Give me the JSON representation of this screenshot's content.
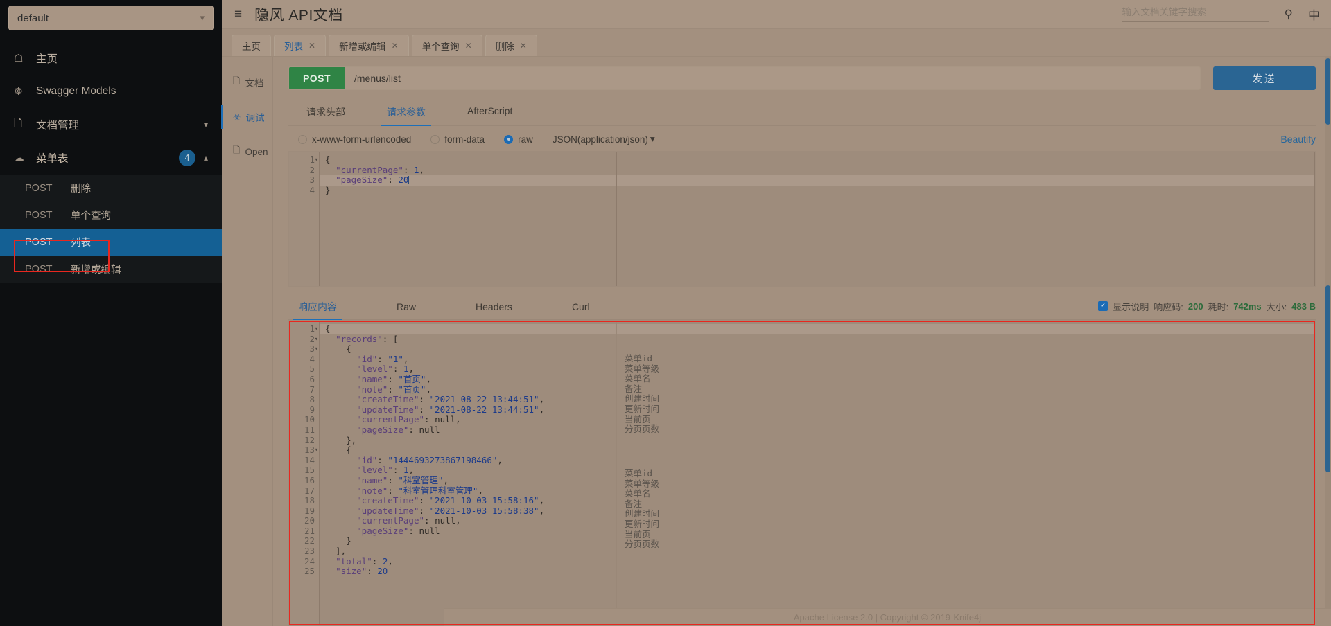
{
  "sidebar": {
    "env": {
      "value": "default",
      "chevron": "chevron-down-icon"
    },
    "nav": [
      {
        "icon": "home-icon",
        "glyph": "⌂",
        "label": "主页"
      },
      {
        "icon": "swagger-icon",
        "glyph": "☸",
        "label": "Swagger Models"
      },
      {
        "icon": "doc-icon",
        "glyph": "὜8",
        "label": "文档管理",
        "caret": "ˇ"
      },
      {
        "icon": "cloud-icon",
        "glyph": "☁",
        "label": "菜单表",
        "badge": "4",
        "caret": "˄"
      }
    ],
    "endpoints": [
      {
        "method": "POST",
        "name": "删除",
        "selected": false
      },
      {
        "method": "POST",
        "name": "单个查询",
        "selected": false
      },
      {
        "method": "POST",
        "name": "列表",
        "selected": true
      },
      {
        "method": "POST",
        "name": "新增或编辑",
        "selected": false
      }
    ]
  },
  "topbar": {
    "collapse_icon": "collapse-sidebar-icon",
    "title": "隐风 API文档",
    "search_placeholder": "输入文档关键字搜索",
    "search_value": "",
    "search_icon": "search-icon",
    "lang_label": "中"
  },
  "tabs": [
    {
      "label": "主页",
      "closable": false,
      "active": false
    },
    {
      "label": "列表",
      "closable": true,
      "active": true
    },
    {
      "label": "新增或编辑",
      "closable": true,
      "active": false
    },
    {
      "label": "单个查询",
      "closable": true,
      "active": false
    },
    {
      "label": "删除",
      "closable": true,
      "active": false
    }
  ],
  "leftnav": [
    {
      "icon": "document-icon",
      "glyph": "὜b",
      "label": "文档",
      "active": false
    },
    {
      "icon": "bug-icon",
      "glyph": "☣",
      "label": "调试",
      "active": true
    },
    {
      "icon": "open-file-icon",
      "glyph": "὜b",
      "label": "Open",
      "active": false
    }
  ],
  "request": {
    "method": "POST",
    "url": "/menus/list",
    "send_label": "发送",
    "subtabs": [
      {
        "label": "请求头部",
        "active": false
      },
      {
        "label": "请求参数",
        "active": true
      },
      {
        "label": "AfterScript",
        "active": false
      }
    ],
    "body_types": [
      {
        "label": "x-www-form-urlencoded",
        "selected": false
      },
      {
        "label": "form-data",
        "selected": false
      },
      {
        "label": "raw",
        "selected": true
      }
    ],
    "content_type": "JSON(application/json)",
    "content_type_caret": "⌄",
    "beautify_label": "Beautify",
    "body_lines": [
      {
        "n": "1",
        "fold": true,
        "html": "{"
      },
      {
        "n": "2",
        "fold": false,
        "html": "  <span class='k'>\"currentPage\"</span>: <span class='n'>1</span>,"
      },
      {
        "n": "3",
        "fold": false,
        "hl": true,
        "html": "  <span class='k'>\"pageSize\"</span>: <span class='n'>20</span><span class='caret-bar'></span>"
      },
      {
        "n": "4",
        "fold": false,
        "html": "}"
      }
    ]
  },
  "response": {
    "tabs": [
      {
        "label": "响应内容",
        "active": true
      },
      {
        "label": "Raw",
        "active": false
      },
      {
        "label": "Headers",
        "active": false
      },
      {
        "label": "Curl",
        "active": false
      }
    ],
    "show_desc_label": "显示说明",
    "show_desc_checked": true,
    "status_code_label": "响应码:",
    "status_code_value": "200",
    "time_label": "耗时:",
    "time_value": "742ms",
    "size_label": "大小:",
    "size_value": "483 B",
    "body_lines": [
      {
        "n": "1",
        "fold": true,
        "hl": true,
        "html": "{"
      },
      {
        "n": "2",
        "fold": true,
        "html": "  <span class='k'>\"records\"</span>: ["
      },
      {
        "n": "3",
        "fold": true,
        "html": "    {"
      },
      {
        "n": "4",
        "fold": false,
        "html": "      <span class='k'>\"id\"</span>: <span class='s'>\"1\"</span>,"
      },
      {
        "n": "5",
        "fold": false,
        "html": "      <span class='k'>\"level\"</span>: <span class='n'>1</span>,"
      },
      {
        "n": "6",
        "fold": false,
        "html": "      <span class='k'>\"name\"</span>: <span class='cz'>\"首页\"</span>,"
      },
      {
        "n": "7",
        "fold": false,
        "html": "      <span class='k'>\"note\"</span>: <span class='cz'>\"首页\"</span>,"
      },
      {
        "n": "8",
        "fold": false,
        "html": "      <span class='k'>\"createTime\"</span>: <span class='s'>\"2021-08-22 13:44:51\"</span>,"
      },
      {
        "n": "9",
        "fold": false,
        "html": "      <span class='k'>\"updateTime\"</span>: <span class='s'>\"2021-08-22 13:44:51\"</span>,"
      },
      {
        "n": "10",
        "fold": false,
        "html": "      <span class='k'>\"currentPage\"</span>: <span class='nul'>null</span>,"
      },
      {
        "n": "11",
        "fold": false,
        "html": "      <span class='k'>\"pageSize\"</span>: <span class='nul'>null</span>"
      },
      {
        "n": "12",
        "fold": false,
        "html": "    },"
      },
      {
        "n": "13",
        "fold": true,
        "html": "    {"
      },
      {
        "n": "14",
        "fold": false,
        "html": "      <span class='k'>\"id\"</span>: <span class='s'>\"1444693273867198466\"</span>,"
      },
      {
        "n": "15",
        "fold": false,
        "html": "      <span class='k'>\"level\"</span>: <span class='n'>1</span>,"
      },
      {
        "n": "16",
        "fold": false,
        "html": "      <span class='k'>\"name\"</span>: <span class='cz'>\"科室管理\"</span>,"
      },
      {
        "n": "17",
        "fold": false,
        "html": "      <span class='k'>\"note\"</span>: <span class='cz'>\"科室管理科室管理\"</span>,"
      },
      {
        "n": "18",
        "fold": false,
        "html": "      <span class='k'>\"createTime\"</span>: <span class='s'>\"2021-10-03 15:58:16\"</span>,"
      },
      {
        "n": "19",
        "fold": false,
        "html": "      <span class='k'>\"updateTime\"</span>: <span class='s'>\"2021-10-03 15:58:38\"</span>,"
      },
      {
        "n": "20",
        "fold": false,
        "html": "      <span class='k'>\"currentPage\"</span>: <span class='nul'>null</span>,"
      },
      {
        "n": "21",
        "fold": false,
        "html": "      <span class='k'>\"pageSize\"</span>: <span class='nul'>null</span>"
      },
      {
        "n": "22",
        "fold": false,
        "html": "    }"
      },
      {
        "n": "23",
        "fold": false,
        "html": "  ],"
      },
      {
        "n": "24",
        "fold": false,
        "html": "  <span class='k'>\"total\"</span>: <span class='n'>2</span>,"
      },
      {
        "n": "25",
        "fold": false,
        "html": "  <span class='k'>\"size\"</span>: <span class='n'>20</span>"
      }
    ],
    "descriptions_block1": "菜单id\n菜单等级\n菜单名\n备注\n创建时间\n更新时间\n当前页\n分页页数",
    "descriptions_block2": "菜单id\n菜单等级\n菜单名\n备注\n创建时间\n更新时间\n当前页\n分页页数"
  },
  "footer": {
    "text": "Apache License 2.0 | Copyright © 2019-Knife4j"
  },
  "colors": {
    "accent_blue": "#1d6fb8",
    "method_green": "#2f8445",
    "selected_row": "#146094",
    "highlight_box": "#e8271f",
    "status_green": "#2c6b3b"
  }
}
